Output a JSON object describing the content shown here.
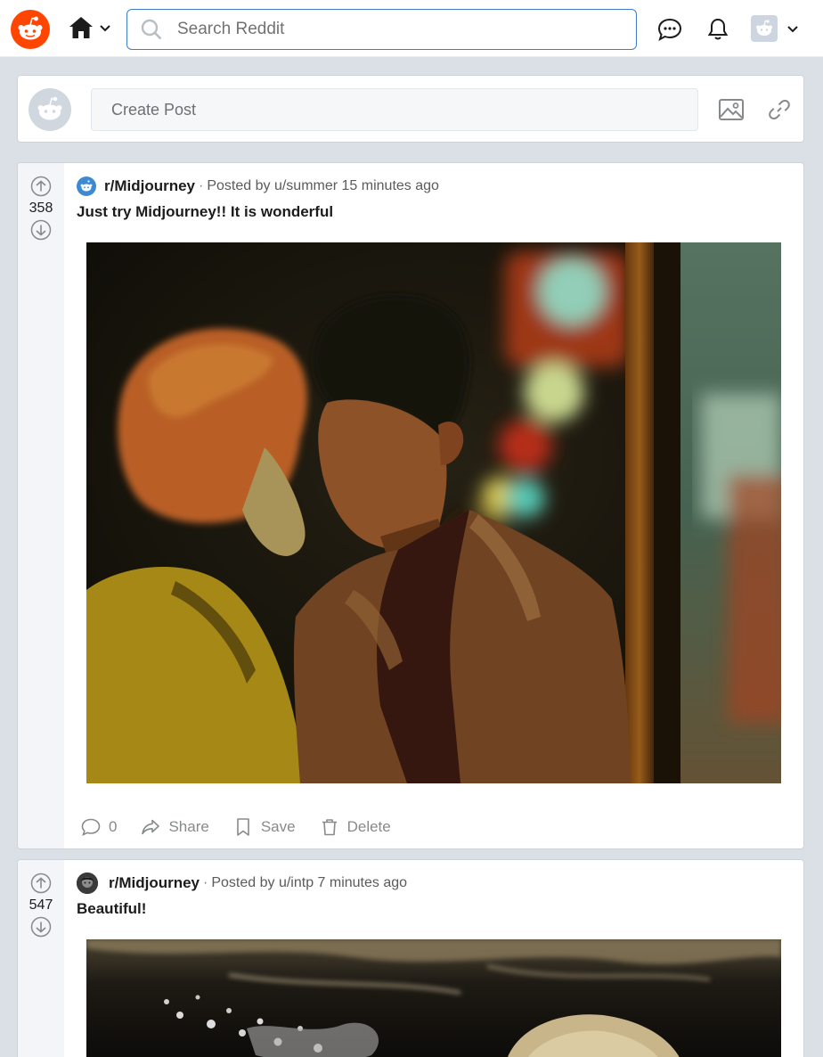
{
  "header": {
    "search_placeholder": "Search Reddit",
    "icons": [
      "reddit-logo-icon",
      "home-icon",
      "chevron-down-icon",
      "search-icon",
      "chat-icon",
      "bell-icon",
      "user-avatar-icon"
    ]
  },
  "create_post": {
    "placeholder": "Create Post",
    "icons": [
      "image-icon",
      "link-icon"
    ]
  },
  "posts": [
    {
      "votes": "358",
      "subreddit": "r/Midjourney",
      "separator": "·",
      "posted_by": "Posted by u/summer 15 minutes ago",
      "title": "Just try Midjourney!! It is wonderful",
      "comments": "0",
      "share_label": "Share",
      "save_label": "Save",
      "delete_label": "Delete"
    },
    {
      "votes": "547",
      "subreddit": "r/Midjourney",
      "separator": "·",
      "posted_by": "Posted by u/intp 7 minutes ago",
      "title": "Beautiful!"
    }
  ],
  "colors": {
    "brand": "#ff4500",
    "page_bg": "#dae0e6",
    "search_border": "#3f7ec9",
    "vote_col_bg": "#f3f5f8",
    "muted": "#878a8c"
  }
}
